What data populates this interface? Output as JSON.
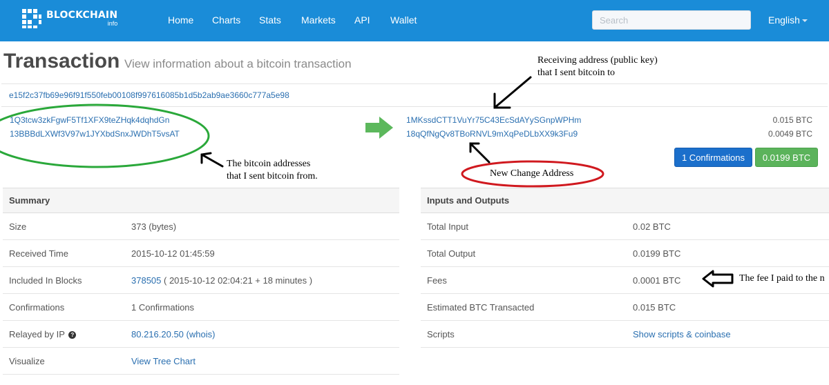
{
  "brand": {
    "name": "BLOCKCHAIN",
    "sub": "info"
  },
  "nav": [
    "Home",
    "Charts",
    "Stats",
    "Markets",
    "API",
    "Wallet"
  ],
  "search": {
    "placeholder": "Search"
  },
  "language": "English",
  "page": {
    "title": "Transaction",
    "subtitle": "View information about a bitcoin transaction"
  },
  "tx": {
    "hash": "e15f2c37fb69e96f91f550feb00108f997616085b1d5b2ab9ae3660c777a5e98",
    "inputs": [
      "1Q3tcw3zkFgwF5Tf1XFX9teZHqk4dqhdGn",
      "13BBBdLXWf3V97w1JYXbdSnxJWDhT5vsAT"
    ],
    "outputs": [
      {
        "address": "1MKssdCTT1VuYr75C43EcSdAYySGnpWPHm",
        "amount": "0.015 BTC"
      },
      {
        "address": "18qQfNgQv8TBoRNVL9mXqPeDLbXX9k3Fu9",
        "amount": "0.0049 BTC"
      }
    ],
    "confirmations_button": "1 Confirmations",
    "total_button": "0.0199 BTC"
  },
  "summary": {
    "header": "Summary",
    "size": {
      "label": "Size",
      "value": "373 (bytes)"
    },
    "received": {
      "label": "Received Time",
      "value": "2015-10-12 01:45:59"
    },
    "included": {
      "label": "Included In Blocks",
      "block": "378505",
      "rest": "( 2015-10-12 02:04:21 + 18 minutes )"
    },
    "confirmations": {
      "label": "Confirmations",
      "value": "1 Confirmations"
    },
    "relayed": {
      "label": "Relayed by IP",
      "ip": "80.216.20.50",
      "whois": "(whois)"
    },
    "visualize": {
      "label": "Visualize",
      "link": "View Tree Chart"
    }
  },
  "io": {
    "header": "Inputs and Outputs",
    "total_input": {
      "label": "Total Input",
      "value": "0.02 BTC"
    },
    "total_output": {
      "label": "Total Output",
      "value": "0.0199 BTC"
    },
    "fees": {
      "label": "Fees",
      "value": "0.0001 BTC"
    },
    "estimated": {
      "label": "Estimated BTC Transacted",
      "value": "0.015 BTC"
    },
    "scripts": {
      "label": "Scripts",
      "link": "Show scripts & coinbase"
    }
  },
  "annotations": {
    "receiving_1": "Receiving address (public key)",
    "receiving_2": "that I sent bitcoin to",
    "from_1": "The bitcoin addresses",
    "from_2": "that I sent bitcoin from.",
    "change": "New Change Address",
    "fee": "The fee I paid to the n"
  },
  "colors": {
    "navbar": "#1a8cd8",
    "link": "#2a6fb0",
    "button_blue": "#1b6fcb",
    "button_green": "#5bb35b",
    "green_ellipse": "#2aa83a",
    "red_ellipse": "#d0191f"
  }
}
